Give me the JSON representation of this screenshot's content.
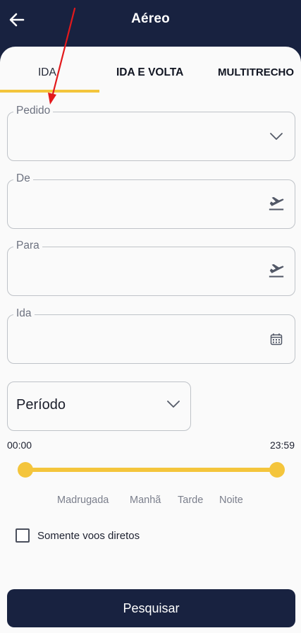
{
  "header": {
    "title": "Aéreo",
    "back_icon": "arrow-left-icon"
  },
  "tabs": [
    {
      "label": "IDA",
      "selected": true
    },
    {
      "label": "IDA E VOLTA",
      "selected": false
    },
    {
      "label": "MULTITRECHO",
      "selected": false
    }
  ],
  "form": {
    "pedido": {
      "label": "Pedido",
      "value": "",
      "icon": "chevron-down-icon"
    },
    "de": {
      "label": "De",
      "value": "",
      "icon": "airplane-departure-icon"
    },
    "para": {
      "label": "Para",
      "value": "",
      "icon": "airplane-departure-icon"
    },
    "ida": {
      "label": "Ida",
      "value": "",
      "icon": "calendar-icon"
    }
  },
  "periodo": {
    "label": "Período",
    "icon": "chevron-down-icon"
  },
  "time_range": {
    "start": "00:00",
    "end": "23:59"
  },
  "periods": [
    "Madrugada",
    "Manhã",
    "Tarde",
    "Noite"
  ],
  "direct_flights": {
    "label": "Somente voos diretos",
    "checked": false
  },
  "search_button": {
    "label": "Pesquisar"
  },
  "colors": {
    "header_bg": "#182240",
    "accent": "#f4c53c",
    "annotation_arrow": "#e3191c"
  }
}
